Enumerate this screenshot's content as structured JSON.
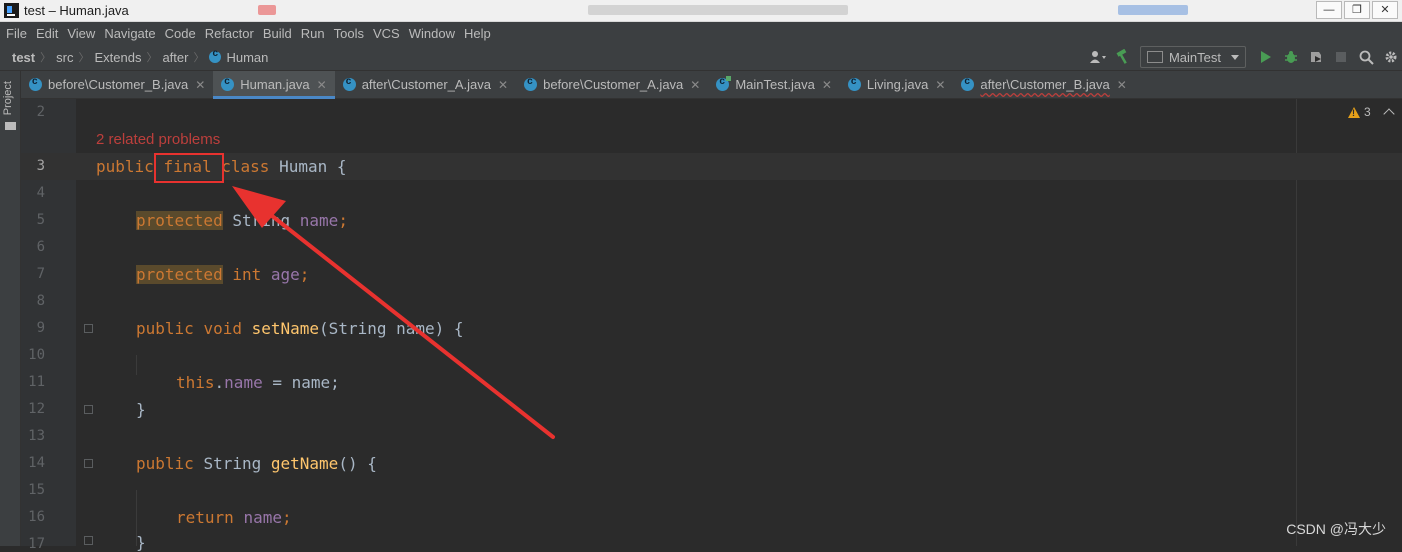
{
  "window": {
    "title": "test – Human.java",
    "controls": [
      "—",
      "❐",
      "✕"
    ]
  },
  "menu": [
    "File",
    "Edit",
    "View",
    "Navigate",
    "Code",
    "Refactor",
    "Build",
    "Run",
    "Tools",
    "VCS",
    "Window",
    "Help"
  ],
  "breadcrumb": [
    "test",
    "src",
    "Extends",
    "after",
    "Human"
  ],
  "toolbar": {
    "run_config": "MainTest"
  },
  "sidebar": {
    "project_label": "Project"
  },
  "tabs": [
    {
      "label": "before\\Customer_B.java",
      "active": false,
      "error": false
    },
    {
      "label": "Human.java",
      "active": true,
      "error": false
    },
    {
      "label": "after\\Customer_A.java",
      "active": false,
      "error": false
    },
    {
      "label": "before\\Customer_A.java",
      "active": false,
      "error": false
    },
    {
      "label": "MainTest.java",
      "active": false,
      "error": false
    },
    {
      "label": "Living.java",
      "active": false,
      "error": false
    },
    {
      "label": "after\\Customer_B.java",
      "active": false,
      "error": true
    }
  ],
  "editor": {
    "problems_hint": "2 related problems",
    "warning_count": "3",
    "line_numbers": [
      "2",
      "3",
      "4",
      "5",
      "6",
      "7",
      "8",
      "9",
      "10",
      "11",
      "12",
      "13",
      "14",
      "15",
      "16",
      "17"
    ],
    "code": {
      "l3": {
        "k1": "public",
        "k2": "final",
        "k3": "class",
        "name": "Human",
        "brace": "{"
      },
      "l5": {
        "k1": "protected",
        "type": "String",
        "field": "name",
        "semi": ";"
      },
      "l7": {
        "k1": "protected",
        "type": "int",
        "field": "age",
        "semi": ";"
      },
      "l9": {
        "k1": "public",
        "k2": "void",
        "method": "setName",
        "params": "(String name) {"
      },
      "l11": {
        "k1": "this",
        "dot": ".",
        "field": "name",
        "rest": " = name;"
      },
      "l12": {
        "text": "}"
      },
      "l14": {
        "k1": "public",
        "type": "String",
        "method": "getName",
        "rest": "() {"
      },
      "l16": {
        "k1": "return",
        "field": "name",
        "semi": ";"
      },
      "l17": {
        "text": "}"
      }
    }
  },
  "annotation": {
    "color": "#e8322f"
  },
  "watermark": "CSDN @冯大少"
}
